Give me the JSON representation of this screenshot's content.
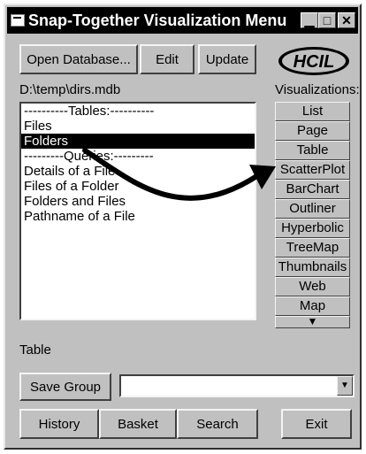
{
  "window": {
    "title": "Snap-Together Visualization Menu",
    "controls": {
      "minimize": "▁",
      "maximize": "□",
      "close": "✕"
    }
  },
  "toolbar": {
    "open_database": "Open Database...",
    "edit": "Edit",
    "update": "Update"
  },
  "logo": {
    "text": "HCIL"
  },
  "database_path": "D:\\temp\\dirs.mdb",
  "visualizations_label": "Visualizations:",
  "list": {
    "items": [
      "----------Tables:----------",
      "Files",
      "Folders",
      "---------Queries:---------",
      "Details of a File",
      "Files of a Folder",
      "Folders and Files",
      "Pathname of a File"
    ],
    "selected_index": 2
  },
  "visualizations": [
    "List",
    "Page",
    "Table",
    "ScatterPlot",
    "BarChart",
    "Outliner",
    "Hyperbolic",
    "TreeMap",
    "Thumbnails",
    "Web",
    "Map"
  ],
  "viz_more_icon": "▼",
  "status_text": "Table",
  "group": {
    "save_label": "Save Group",
    "combo_value": "",
    "combo_arrow": "▼"
  },
  "bottom": {
    "history": "History",
    "basket": "Basket",
    "search": "Search",
    "exit": "Exit"
  },
  "colors": {
    "face": "#c0c0c0",
    "titlebar": "#000000",
    "selection": "#000000"
  }
}
